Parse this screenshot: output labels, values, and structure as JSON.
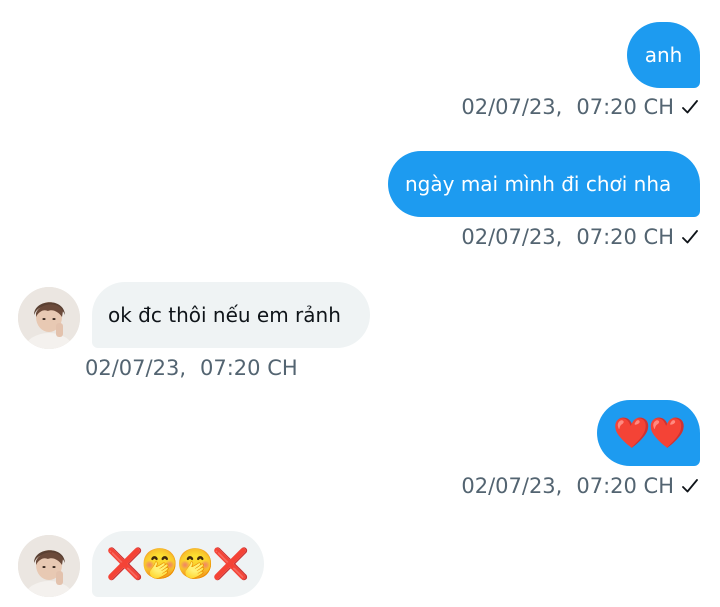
{
  "messages": [
    {
      "direction": "outgoing",
      "text": "anh",
      "date": "02/07/23,",
      "time": "07:20 CH",
      "read_icon": "check-icon"
    },
    {
      "direction": "outgoing",
      "text": "ngày mai mình đi chơi nha",
      "date": "02/07/23,",
      "time": "07:20 CH",
      "read_icon": "check-icon"
    },
    {
      "direction": "incoming",
      "text": "ok đc thôi nếu em rảnh",
      "date": "02/07/23,",
      "time": "07:20 CH"
    },
    {
      "direction": "outgoing",
      "text": "❤️❤️",
      "date": "02/07/23,",
      "time": "07:20 CH",
      "read_icon": "check-icon"
    },
    {
      "direction": "incoming",
      "text": "❌🤭🤭❌"
    }
  ],
  "colors": {
    "outgoing_bubble": "#1d9bf0",
    "incoming_bubble": "#eff3f4",
    "meta_text": "#536471"
  }
}
